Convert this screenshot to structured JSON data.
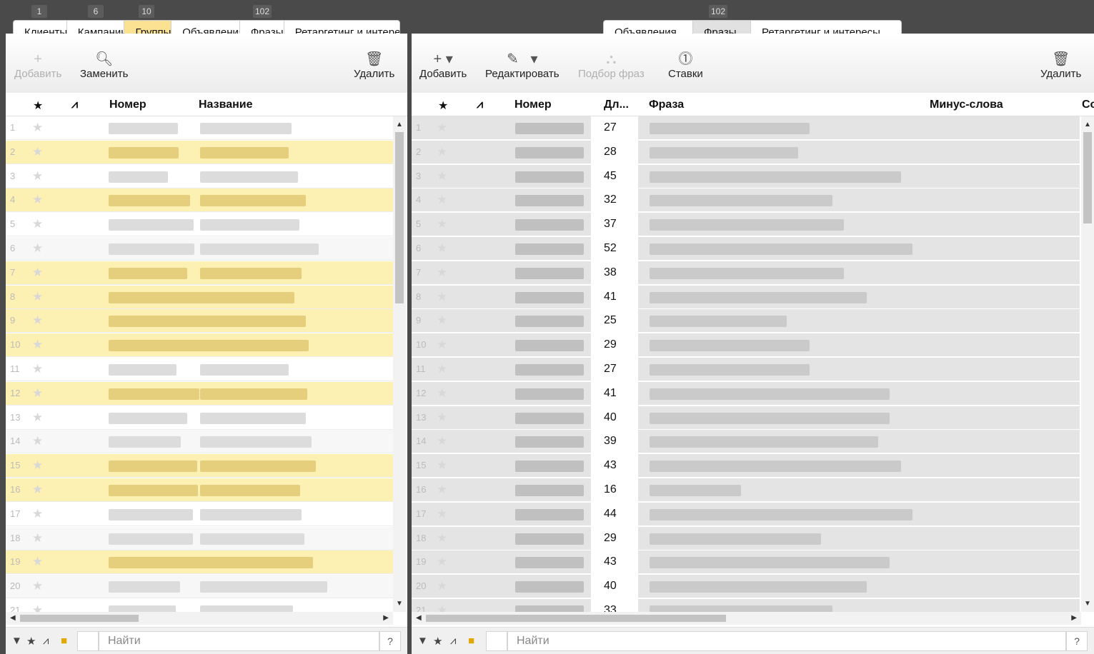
{
  "left": {
    "tabs": [
      {
        "label": "Клиенты",
        "count": "1"
      },
      {
        "label": "Кампании",
        "count": "6"
      },
      {
        "label": "Группы",
        "count": "10"
      },
      {
        "label": "Объявления",
        "count": ""
      },
      {
        "label": "Фразы",
        "count": "102"
      },
      {
        "label": "Ретаргетинг и интересы",
        "count": ""
      }
    ],
    "toolbar": {
      "add": "Добавить",
      "replace": "Заменить",
      "delete": "Удалить"
    },
    "columns": {
      "number": "Номер",
      "name": "Название"
    },
    "rows": [
      "1",
      "2",
      "3",
      "4",
      "5",
      "6",
      "7",
      "8",
      "9",
      "10",
      "11",
      "12",
      "13",
      "14",
      "15",
      "16",
      "17",
      "18",
      "19",
      "20",
      "21"
    ],
    "highlighted": [
      2,
      4,
      7,
      8,
      9,
      10,
      12,
      15,
      16,
      19
    ],
    "search_placeholder": "Найти",
    "help": "?"
  },
  "right": {
    "tabs": [
      {
        "label": "Объявления",
        "count": ""
      },
      {
        "label": "Фразы",
        "count": "102"
      },
      {
        "label": "Ретаргетинг и интересы",
        "count": ""
      }
    ],
    "toolbar": {
      "add": "Добавить",
      "edit": "Редактировать",
      "pick": "Подбор фраз",
      "bids": "Ставки",
      "delete": "Удалить"
    },
    "columns": {
      "number": "Номер",
      "length": "Дл...",
      "phrase": "Фраза",
      "minus": "Минус-слова",
      "extra": "Со"
    },
    "rows": [
      {
        "n": "1",
        "len": "27"
      },
      {
        "n": "2",
        "len": "28"
      },
      {
        "n": "3",
        "len": "45"
      },
      {
        "n": "4",
        "len": "32"
      },
      {
        "n": "5",
        "len": "37"
      },
      {
        "n": "6",
        "len": "52"
      },
      {
        "n": "7",
        "len": "38"
      },
      {
        "n": "8",
        "len": "41"
      },
      {
        "n": "9",
        "len": "25"
      },
      {
        "n": "10",
        "len": "29"
      },
      {
        "n": "11",
        "len": "27"
      },
      {
        "n": "12",
        "len": "41"
      },
      {
        "n": "13",
        "len": "40"
      },
      {
        "n": "14",
        "len": "39"
      },
      {
        "n": "15",
        "len": "43"
      },
      {
        "n": "16",
        "len": "16"
      },
      {
        "n": "17",
        "len": "44"
      },
      {
        "n": "18",
        "len": "29"
      },
      {
        "n": "19",
        "len": "43"
      },
      {
        "n": "20",
        "len": "40"
      },
      {
        "n": "21",
        "len": "33"
      }
    ],
    "search_placeholder": "Найти",
    "help": "?"
  },
  "colors": {
    "highlight": "#fdf0b3",
    "selected_row": "#e4e4e4",
    "active_tab_yellow": "#fbe192"
  }
}
